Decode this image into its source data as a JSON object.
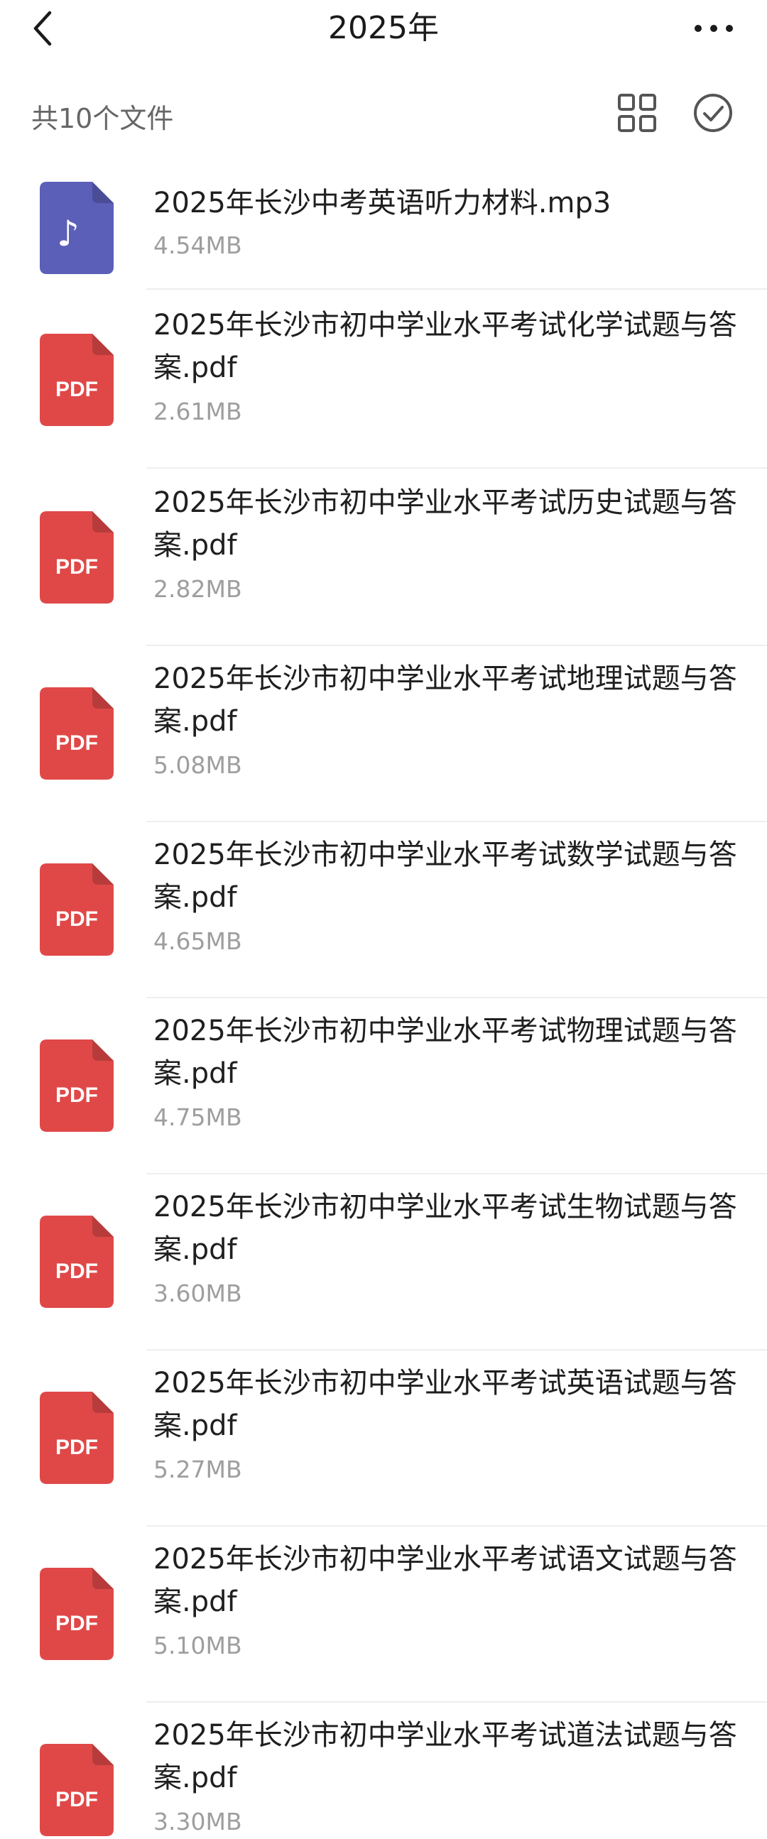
{
  "header": {
    "title": "2025年",
    "back_icon": "chevron-left-icon",
    "more_icon": "more-horizontal-icon"
  },
  "toolbar": {
    "file_count": "共10个文件",
    "grid_icon": "grid-view-icon",
    "select_icon": "check-circle-icon"
  },
  "colors": {
    "pdf_red": "#e04848",
    "audio_purple": "#5b5fb8",
    "size_gray": "#9e9e9e"
  },
  "files": [
    {
      "type": "audio",
      "icon_label": "♪",
      "name": "2025年长沙中考英语听力材料.mp3",
      "size": "4.54MB"
    },
    {
      "type": "pdf",
      "icon_label": "PDF",
      "name": "2025年长沙市初中学业水平考试化学试题与答案.pdf",
      "size": "2.61MB"
    },
    {
      "type": "pdf",
      "icon_label": "PDF",
      "name": "2025年长沙市初中学业水平考试历史试题与答案.pdf",
      "size": "2.82MB"
    },
    {
      "type": "pdf",
      "icon_label": "PDF",
      "name": "2025年长沙市初中学业水平考试地理试题与答案.pdf",
      "size": "5.08MB"
    },
    {
      "type": "pdf",
      "icon_label": "PDF",
      "name": "2025年长沙市初中学业水平考试数学试题与答案.pdf",
      "size": "4.65MB"
    },
    {
      "type": "pdf",
      "icon_label": "PDF",
      "name": "2025年长沙市初中学业水平考试物理试题与答案.pdf",
      "size": "4.75MB"
    },
    {
      "type": "pdf",
      "icon_label": "PDF",
      "name": "2025年长沙市初中学业水平考试生物试题与答案.pdf",
      "size": "3.60MB"
    },
    {
      "type": "pdf",
      "icon_label": "PDF",
      "name": "2025年长沙市初中学业水平考试英语试题与答案.pdf",
      "size": "5.27MB"
    },
    {
      "type": "pdf",
      "icon_label": "PDF",
      "name": "2025年长沙市初中学业水平考试语文试题与答案.pdf",
      "size": "5.10MB"
    },
    {
      "type": "pdf",
      "icon_label": "PDF",
      "name": "2025年长沙市初中学业水平考试道法试题与答案.pdf",
      "size": "3.30MB"
    }
  ]
}
